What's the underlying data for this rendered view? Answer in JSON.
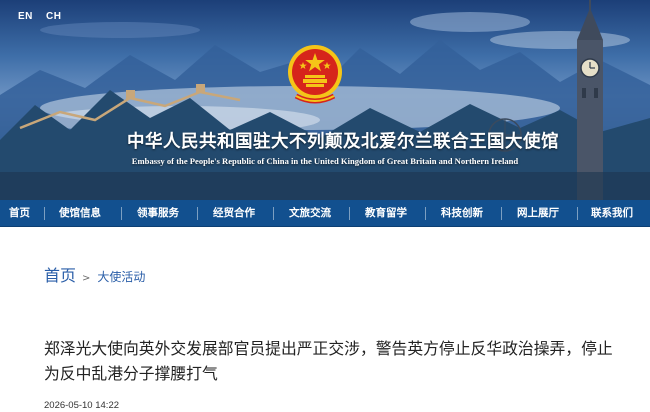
{
  "header": {
    "languages": [
      "EN",
      "CH"
    ],
    "title_cn": "中华人民共和国驻大不列颠及北爱尔兰联合王国大使馆",
    "title_en": "Embassy of the People's Republic of China in the United Kingdom of Great Britain and Northern Ireland"
  },
  "nav": {
    "items": [
      "首页",
      "使馆信息",
      "领事服务",
      "经贸合作",
      "文旅交流",
      "教育留学",
      "科技创新",
      "网上展厅",
      "联系我们"
    ]
  },
  "breadcrumb": {
    "home": "首页",
    "separator": ">",
    "current": "大使活动"
  },
  "article": {
    "title": "郑泽光大使向英外交发展部官员提出严正交涉，警告英方停止反华政治操弄，停止为反中乱港分子撑腰打气",
    "date": "2026-05-10 14:22"
  },
  "colors": {
    "nav_background": "#12508f",
    "link": "#2a5ea8",
    "emblem_red": "#d6251b",
    "emblem_gold": "#f5c518"
  }
}
